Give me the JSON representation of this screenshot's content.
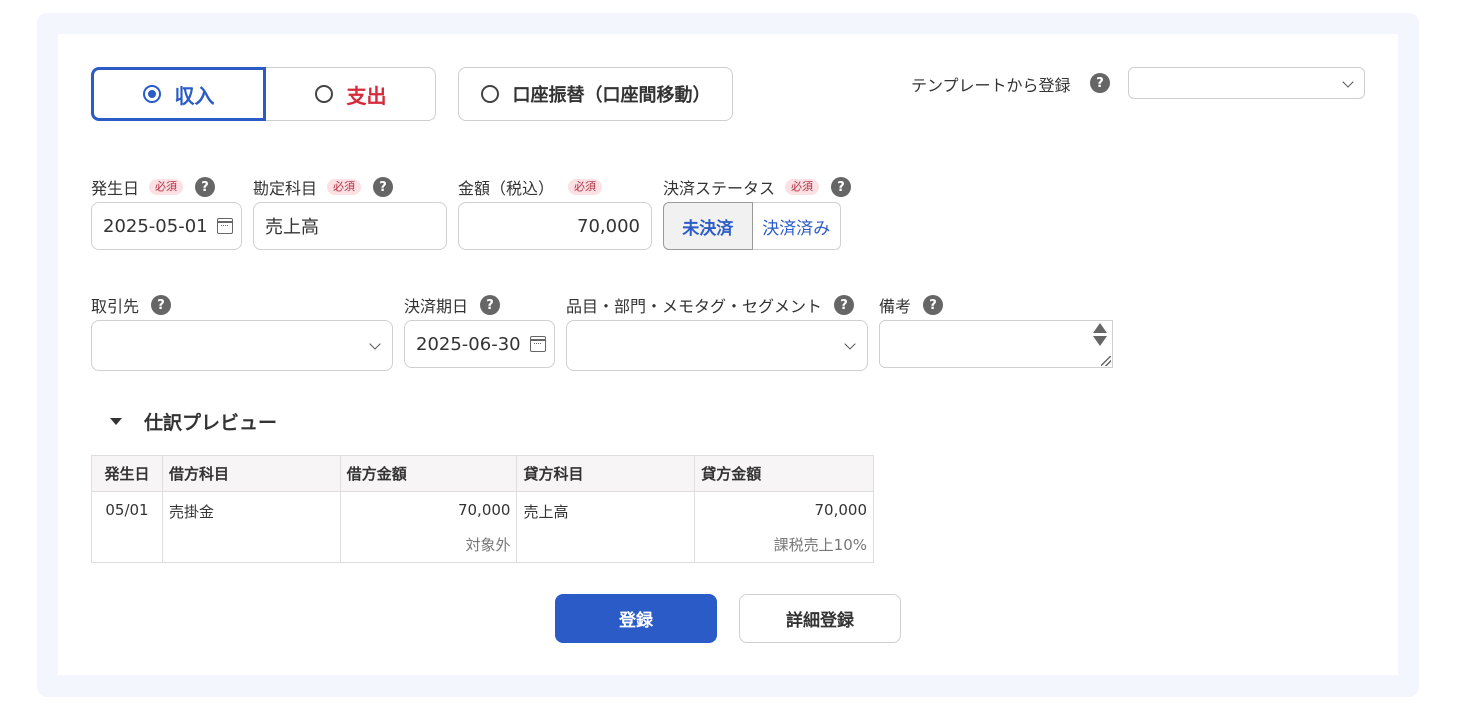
{
  "type_tabs": {
    "income": "収入",
    "expense": "支出",
    "transfer": "口座振替（口座間移動）",
    "selected": "income"
  },
  "template": {
    "label": "テンプレートから登録",
    "value": ""
  },
  "help_glyph": "?",
  "required_badge": "必須",
  "fields": {
    "issue_date": {
      "label": "発生日",
      "value": "2025-05-01"
    },
    "account": {
      "label": "勘定科目",
      "value": "売上高"
    },
    "amount": {
      "label": "金額（税込）",
      "value": "70,000"
    },
    "settlement_status": {
      "label": "決済ステータス",
      "options": [
        "未決済",
        "決済済み"
      ],
      "selected": "未決済"
    },
    "partner": {
      "label": "取引先",
      "value": ""
    },
    "due_date": {
      "label": "決済期日",
      "value": "2025-06-30"
    },
    "tags": {
      "label": "品目・部門・メモタグ・セグメント",
      "value": ""
    },
    "memo": {
      "label": "備考",
      "value": ""
    }
  },
  "preview": {
    "title": "仕訳プレビュー",
    "headers": [
      "発生日",
      "借方科目",
      "借方金額",
      "貸方科目",
      "貸方金額"
    ],
    "row": {
      "date": "05/01",
      "debit_account": "売掛金",
      "debit_amount": "70,000",
      "debit_tax": "対象外",
      "credit_account": "売上高",
      "credit_amount": "70,000",
      "credit_tax": "課税売上10%"
    }
  },
  "actions": {
    "submit": "登録",
    "detail": "詳細登録"
  },
  "colors": {
    "accent": "#2a5bc7",
    "expense": "#d42a3a",
    "required_bg": "#fbe0e4",
    "frame_bg": "#f3f6fc"
  }
}
